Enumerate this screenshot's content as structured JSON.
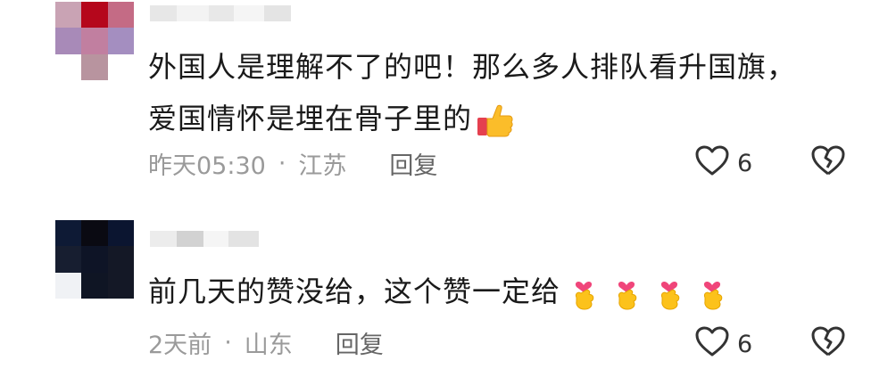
{
  "comments": [
    {
      "text_line1": "外国人是理解不了的吧！那么多人排队看升国旗，",
      "text_line2": "爱国情怀是埋在骨子里的",
      "emoji": "thumbs-up-icon",
      "time": "昨天05:30",
      "separator": "·",
      "location": "江苏",
      "reply_label": "回复",
      "likes": "6",
      "avatar_colors": [
        "#c9a3b4",
        "#b5071c",
        "#c46b85",
        "#a88ab8",
        "#c17fa0",
        "#a48ec0",
        "#ffffff",
        "#b8949f",
        "#ffffff"
      ],
      "username_blocks": [
        "#e7e7e7",
        "#f3f3f3",
        "#e8e8e8",
        "#f5f5f5",
        "#e4e4e4"
      ]
    },
    {
      "text_line1": "前几天的赞没给，这个赞一定给",
      "emoji": "finger-heart-icon",
      "emoji_count": 4,
      "time": "2天前",
      "separator": "·",
      "location": "山东",
      "reply_label": "回复",
      "likes": "6",
      "avatar_colors": [
        "#0e1a35",
        "#0a0a12",
        "#0b1530",
        "#171e30",
        "#0e1426",
        "#141826",
        "#f0f2f5",
        "#0f1524",
        "#141826"
      ],
      "username_blocks": [
        "#ececec",
        "#d2d2d2",
        "#f5f5f5",
        "#e3e3e3"
      ]
    }
  ]
}
